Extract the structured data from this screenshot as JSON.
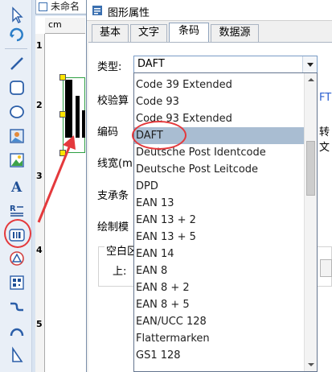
{
  "document": {
    "tab_label": "未命名"
  },
  "ruler": {
    "unit": "cm",
    "marks": [
      "1",
      "2",
      "3",
      "4",
      "5"
    ]
  },
  "dialog": {
    "title": "图形属性",
    "tabs": [
      {
        "label": "基本"
      },
      {
        "label": "文字"
      },
      {
        "label": "条码"
      },
      {
        "label": "数据源"
      }
    ],
    "labels": {
      "type": "类型:",
      "checksum": "校验算",
      "encoding": "编码",
      "line_width": "线宽(m",
      "support": "支承条",
      "draw_mode": "绘制模",
      "whitespace": "空白区",
      "top": "上:"
    },
    "right_partial": {
      "checksum_suffix": "FT",
      "encoding_suffix": "转文"
    },
    "type_select": {
      "value": "DAFT"
    }
  },
  "dropdown": {
    "selected": "DAFT",
    "options": [
      "Code 39 Extended",
      "Code 93",
      "Code 93 Extended",
      "DAFT",
      "Deutsche Post Identcode",
      "Deutsche Post Leitcode",
      "DPD",
      "EAN 13",
      "EAN 13 + 2",
      "EAN 13 + 5",
      "EAN 14",
      "EAN 8",
      "EAN 8 + 2",
      "EAN 8 + 5",
      "EAN/UCC 128",
      "Flattermarken",
      "GS1 128"
    ]
  },
  "colors": {
    "annotation": "#e4393c",
    "selection": "#a9bdd2",
    "accent": "#3a6fb0"
  }
}
